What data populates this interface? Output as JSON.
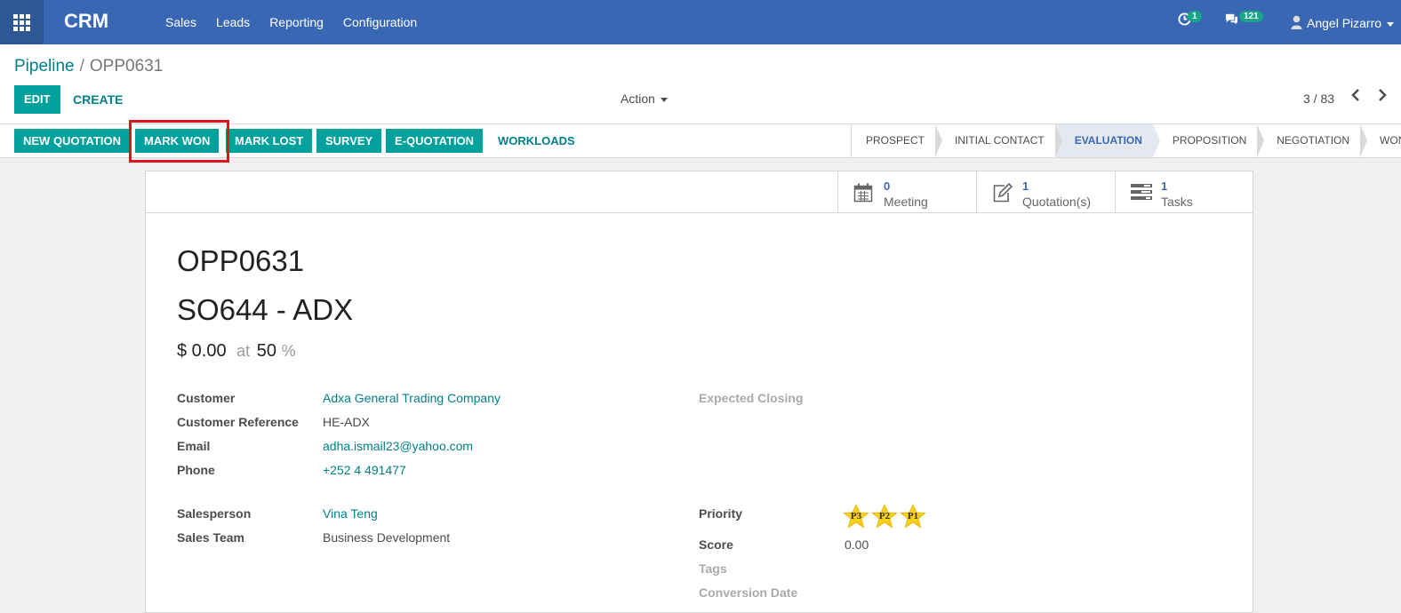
{
  "navbar": {
    "app_name": "CRM",
    "menu": [
      "Sales",
      "Leads",
      "Reporting",
      "Configuration"
    ],
    "activity_count": "1",
    "messages_count": "121",
    "user_name": "Angel Pizarro",
    "brand_color": "#3a67b4"
  },
  "breadcrumb": {
    "parent": "Pipeline",
    "separator": "/",
    "current": "OPP0631"
  },
  "controls": {
    "edit_label": "EDIT",
    "create_label": "CREATE",
    "action_label": "Action",
    "pager": "3 / 83"
  },
  "statusbar": {
    "buttons": [
      "NEW QUOTATION",
      "MARK WON",
      "MARK LOST",
      "SURVEY",
      "E-QUOTATION"
    ],
    "link": "WORKLOADS",
    "stages": [
      "PROSPECT",
      "INITIAL CONTACT",
      "EVALUATION",
      "PROPOSITION",
      "NEGOTIATION",
      "WON"
    ],
    "current_stage": "EVALUATION"
  },
  "smart_buttons": [
    {
      "value": "0",
      "label": "Meeting",
      "icon": "calendar-icon"
    },
    {
      "value": "1",
      "label": "Quotation(s)",
      "icon": "edit-icon"
    },
    {
      "value": "1",
      "label": "Tasks",
      "icon": "tasks-icon"
    }
  ],
  "record": {
    "name": "OPP0631",
    "subject": "SO644 - ADX",
    "revenue": "$ 0.00",
    "at_label": "at",
    "probability": "50",
    "percent_sign": "%",
    "left_fields": [
      {
        "label": "Customer",
        "value": "Adxa General Trading Company"
      },
      {
        "label": "Customer Reference",
        "value": "HE-ADX"
      },
      {
        "label": "Email",
        "value": "adha.ismail23@yahoo.com"
      },
      {
        "label": "Phone",
        "value": "+252 4 491477"
      }
    ],
    "team_fields": [
      {
        "label": "Salesperson",
        "value": "Vina Teng"
      },
      {
        "label": "Sales Team",
        "value": "Business Development"
      }
    ],
    "expected_closing_label": "Expected Closing",
    "priority_label": "Priority",
    "priority_stars": [
      "P3",
      "P2",
      "P1"
    ],
    "score_label": "Score",
    "score_value": "0.00",
    "tags_label": "Tags",
    "conversion_date_label": "Conversion Date"
  }
}
